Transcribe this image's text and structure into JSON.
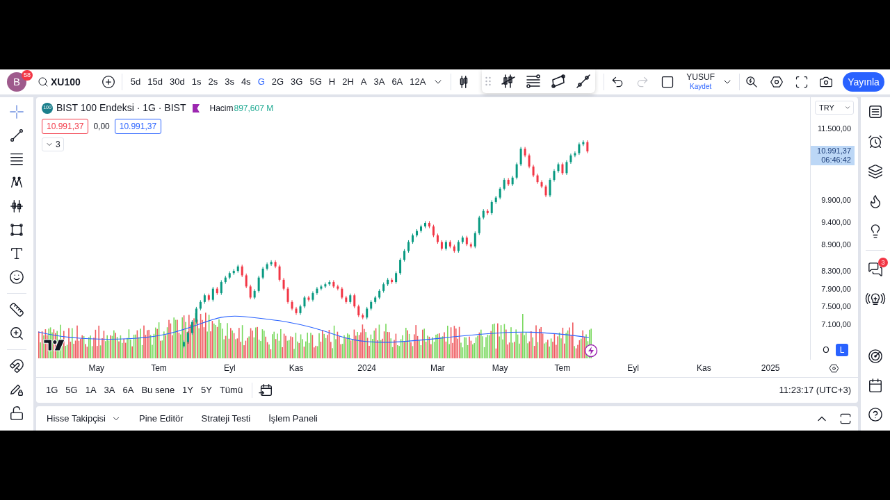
{
  "toolbar": {
    "avatar": {
      "letter": "B",
      "badge": "58"
    },
    "symbol": "XU100",
    "intervals": [
      {
        "label": "5d",
        "selected": false
      },
      {
        "label": "15d",
        "selected": false
      },
      {
        "label": "30d",
        "selected": false
      },
      {
        "label": "1s",
        "selected": false
      },
      {
        "label": "2s",
        "selected": false
      },
      {
        "label": "3s",
        "selected": false
      },
      {
        "label": "4s",
        "selected": false
      },
      {
        "label": "G",
        "selected": true
      },
      {
        "label": "2G",
        "selected": false
      },
      {
        "label": "3G",
        "selected": false
      },
      {
        "label": "5G",
        "selected": false
      },
      {
        "label": "H",
        "selected": false
      },
      {
        "label": "2H",
        "selected": false
      },
      {
        "label": "A",
        "selected": false
      },
      {
        "label": "3A",
        "selected": false
      },
      {
        "label": "6A",
        "selected": false
      },
      {
        "label": "12A",
        "selected": false
      }
    ],
    "history": [
      {
        "disabled": false
      },
      {
        "disabled": true
      }
    ],
    "layout": {
      "name": "YUSUF",
      "status": "Kaydet"
    },
    "publish": "Yayınla"
  },
  "left_tools": [
    {
      "selected": true
    },
    {
      "selected": false
    },
    {
      "selected": false
    },
    {
      "selected": false
    },
    {
      "selected": false
    },
    {
      "selected": false
    },
    {
      "selected": false
    },
    {
      "selected": false
    },
    {
      "selected": false
    },
    {
      "selected": false
    },
    {
      "selected": false
    },
    {
      "selected": false
    },
    {
      "selected": false
    }
  ],
  "legend": {
    "badge": "100",
    "title": "BIST 100 Endeksi · 1G · BIST",
    "volume_label": "Hacim",
    "volume_value": "897,607 M",
    "quotes": [
      {
        "text": "10.991,37",
        "kind": "sell"
      },
      {
        "text": "0,00",
        "kind": "spread"
      },
      {
        "text": "10.991,37",
        "kind": "buy"
      }
    ],
    "indicators": {
      "count": "3",
      "expanded": false
    }
  },
  "chart": {
    "currency": "TRY",
    "last_price": "10.991,37",
    "countdown": "06:46:42",
    "scale_modes": [
      {
        "label": "O",
        "selected": false
      },
      {
        "label": "L",
        "selected": true
      }
    ],
    "chart_data": {
      "type": "candlestick",
      "ylim": [
        6300,
        12210
      ],
      "yticks": [
        {
          "value": 11500,
          "label": "11.500,00"
        },
        {
          "value": 9900,
          "label": "9.900,00"
        },
        {
          "value": 9400,
          "label": "9.400,00"
        },
        {
          "value": 8900,
          "label": "8.900,00"
        },
        {
          "value": 8300,
          "label": "8.300,00"
        },
        {
          "value": 7900,
          "label": "7.900,00"
        },
        {
          "value": 7500,
          "label": "7.500,00"
        },
        {
          "value": 7100,
          "label": "7.100,00"
        }
      ],
      "categories": [
        null,
        null,
        null,
        null,
        null,
        null,
        null,
        null,
        null,
        null,
        null,
        null,
        null,
        null,
        "May",
        null,
        null,
        null,
        null,
        null,
        null,
        null,
        null,
        null,
        null,
        null,
        null,
        null,
        null,
        "Tem",
        null,
        null,
        null,
        null,
        null,
        null,
        null,
        null,
        null,
        null,
        null,
        null,
        null,
        null,
        null,
        null,
        "Eyl",
        null,
        null,
        null,
        null,
        null,
        null,
        null,
        null,
        null,
        null,
        null,
        null,
        null,
        null,
        null,
        "Kas",
        null,
        null,
        null,
        null,
        null,
        null,
        null,
        null,
        null,
        null,
        null,
        null,
        null,
        null,
        null,
        null,
        "2024",
        null,
        null,
        null,
        null,
        null,
        null,
        null,
        null,
        null,
        null,
        null,
        null,
        null,
        null,
        null,
        null,
        "Mar",
        null,
        null,
        null,
        null,
        null,
        null,
        null,
        null,
        null,
        null,
        null,
        null,
        null,
        null,
        "May",
        null,
        null,
        null,
        null,
        null,
        null,
        null,
        null,
        null,
        null,
        null,
        null,
        null,
        null,
        "Tem",
        null,
        null,
        null,
        null,
        null,
        null,
        null,
        null,
        null,
        null,
        null,
        null,
        null,
        null,
        null,
        null,
        "Eyl",
        null,
        null,
        null,
        null,
        null,
        null,
        null,
        null,
        null,
        null,
        null,
        null,
        null,
        null,
        null,
        null,
        "Kas",
        null,
        null,
        null,
        null,
        null,
        null,
        null,
        null,
        null,
        null,
        null,
        null,
        null,
        null,
        null,
        "2025",
        null,
        null,
        null,
        null,
        null,
        null,
        null,
        null,
        null
      ],
      "ohlc": [
        null,
        null,
        null,
        null,
        null,
        null,
        null,
        null,
        null,
        null,
        null,
        null,
        null,
        null,
        null,
        null,
        null,
        null,
        null,
        null,
        null,
        null,
        null,
        null,
        null,
        null,
        null,
        null,
        null,
        null,
        null,
        null,
        null,
        null,
        null,
        [
          6600,
          6740,
          6560,
          6700
        ],
        [
          6700,
          6940,
          6660,
          6900
        ],
        [
          6900,
          7190,
          6860,
          7150
        ],
        [
          7150,
          7490,
          7110,
          7450
        ],
        [
          7450,
          7640,
          7410,
          7600
        ],
        [
          7600,
          7790,
          7560,
          7750
        ],
        [
          7750,
          7790,
          7610,
          7650
        ],
        [
          7650,
          7940,
          7610,
          7900
        ],
        [
          7900,
          7940,
          7760,
          7800
        ],
        [
          7800,
          8090,
          7760,
          8050
        ],
        [
          8050,
          8190,
          8010,
          8150
        ],
        [
          8150,
          8290,
          8110,
          8250
        ],
        [
          8250,
          8340,
          8210,
          8300
        ],
        [
          8300,
          8440,
          8260,
          8400
        ],
        [
          8400,
          8440,
          8160,
          8200
        ],
        [
          8200,
          8240,
          7910,
          7950
        ],
        [
          7950,
          7990,
          7660,
          7700
        ],
        [
          7700,
          7890,
          7660,
          7850
        ],
        [
          7850,
          8190,
          7810,
          8150
        ],
        [
          8150,
          8390,
          8110,
          8350
        ],
        [
          8350,
          8490,
          8310,
          8450
        ],
        [
          8450,
          8540,
          8410,
          8500
        ],
        [
          8500,
          8540,
          8360,
          8400
        ],
        [
          8400,
          8440,
          8060,
          8100
        ],
        [
          8100,
          8140,
          7860,
          7900
        ],
        [
          7900,
          7940,
          7560,
          7600
        ],
        [
          7600,
          7640,
          7410,
          7450
        ],
        [
          7450,
          7490,
          7310,
          7350
        ],
        [
          7350,
          7540,
          7310,
          7500
        ],
        [
          7500,
          7740,
          7460,
          7700
        ],
        [
          7700,
          7740,
          7610,
          7650
        ],
        [
          7650,
          7840,
          7610,
          7800
        ],
        [
          7800,
          7940,
          7760,
          7900
        ],
        [
          7900,
          7990,
          7860,
          7950
        ],
        [
          7950,
          8040,
          7910,
          8000
        ],
        [
          8000,
          8090,
          7960,
          8050
        ],
        [
          8050,
          8090,
          7910,
          7950
        ],
        [
          7950,
          7990,
          7860,
          7900
        ],
        [
          7900,
          7940,
          7660,
          7700
        ],
        [
          7700,
          7740,
          7560,
          7600
        ],
        [
          7600,
          7790,
          7560,
          7750
        ],
        [
          7750,
          7790,
          7460,
          7500
        ],
        [
          7500,
          7540,
          7260,
          7300
        ],
        [
          7300,
          7340,
          7210,
          7250
        ],
        [
          7250,
          7490,
          7210,
          7450
        ],
        [
          7450,
          7640,
          7410,
          7600
        ],
        [
          7600,
          7740,
          7560,
          7700
        ],
        [
          7700,
          7890,
          7660,
          7850
        ],
        [
          7850,
          8040,
          7810,
          8000
        ],
        [
          8000,
          8140,
          7960,
          8100
        ],
        [
          8100,
          8140,
          8010,
          8050
        ],
        [
          8050,
          8290,
          8010,
          8250
        ],
        [
          8250,
          8590,
          8210,
          8550
        ],
        [
          8550,
          8790,
          8510,
          8750
        ],
        [
          8750,
          8990,
          8710,
          8950
        ],
        [
          8950,
          9140,
          8910,
          9100
        ],
        [
          9100,
          9240,
          9060,
          9200
        ],
        [
          9200,
          9340,
          9160,
          9300
        ],
        [
          9300,
          9420,
          9260,
          9380
        ],
        [
          9380,
          9420,
          9260,
          9300
        ],
        [
          9300,
          9340,
          9060,
          9100
        ],
        [
          9100,
          9140,
          8910,
          8950
        ],
        [
          8950,
          8990,
          8760,
          8800
        ],
        [
          8800,
          8990,
          8760,
          8950
        ],
        [
          8950,
          8990,
          8810,
          8850
        ],
        [
          8850,
          8890,
          8710,
          8750
        ],
        [
          8750,
          8990,
          8710,
          8950
        ],
        [
          8950,
          9090,
          8910,
          9050
        ],
        [
          9050,
          9090,
          8860,
          8900
        ],
        [
          8900,
          8940,
          8810,
          8850
        ],
        [
          8850,
          9190,
          8810,
          9150
        ],
        [
          9150,
          9540,
          9110,
          9500
        ],
        [
          9500,
          9690,
          9460,
          9650
        ],
        [
          9650,
          9690,
          9560,
          9600
        ],
        [
          9600,
          9890,
          9560,
          9850
        ],
        [
          9850,
          9990,
          9810,
          9950
        ],
        [
          9950,
          10190,
          9910,
          10150
        ],
        [
          10150,
          10390,
          10110,
          10350
        ],
        [
          10350,
          10390,
          10210,
          10250
        ],
        [
          10250,
          10440,
          10210,
          10400
        ],
        [
          10400,
          10740,
          10360,
          10700
        ],
        [
          10700,
          11090,
          10660,
          11050
        ],
        [
          11050,
          11090,
          10860,
          10900
        ],
        [
          10900,
          10940,
          10610,
          10650
        ],
        [
          10650,
          10690,
          10410,
          10450
        ],
        [
          10450,
          10490,
          10260,
          10300
        ],
        [
          10300,
          10340,
          10160,
          10200
        ],
        [
          10200,
          10240,
          9960,
          10000
        ],
        [
          10000,
          10390,
          9960,
          10350
        ],
        [
          10350,
          10590,
          10310,
          10550
        ],
        [
          10550,
          10740,
          10510,
          10700
        ],
        [
          10700,
          10740,
          10460,
          10500
        ],
        [
          10500,
          10790,
          10460,
          10750
        ],
        [
          10750,
          10940,
          10710,
          10900
        ],
        [
          10900,
          10990,
          10860,
          10950
        ],
        [
          10950,
          11190,
          10910,
          11150
        ],
        [
          11150,
          11240,
          11110,
          11200
        ],
        [
          11200,
          11240,
          10950,
          10990
        ],
        null,
        null,
        null,
        null,
        null,
        null,
        null,
        null,
        null,
        null,
        null,
        null,
        null,
        null,
        null,
        null,
        null,
        null,
        null,
        null,
        null,
        null,
        null,
        null,
        null,
        null,
        null,
        null,
        null,
        null,
        null,
        null,
        null,
        null,
        null,
        null,
        null,
        null,
        null,
        null,
        null,
        null,
        null,
        null,
        null,
        null,
        null,
        null,
        null,
        null,
        null,
        null,
        null
      ]
    }
  },
  "range_bar": {
    "ranges": [
      "1G",
      "5G",
      "1A",
      "3A",
      "6A",
      "Bu sene",
      "1Y",
      "5Y",
      "Tümü"
    ],
    "clock": "11:23:17 (UTC+3)"
  },
  "bottom_panel": {
    "tabs": [
      {
        "label": "Hisse Takipçisi",
        "dropdown": true
      },
      {
        "label": "Pine Editör",
        "dropdown": false
      },
      {
        "label": "Strateji Testi",
        "dropdown": false
      },
      {
        "label": "İşlem Paneli",
        "dropdown": false
      }
    ]
  },
  "right_sidebar": {
    "chat_badge": "3"
  }
}
